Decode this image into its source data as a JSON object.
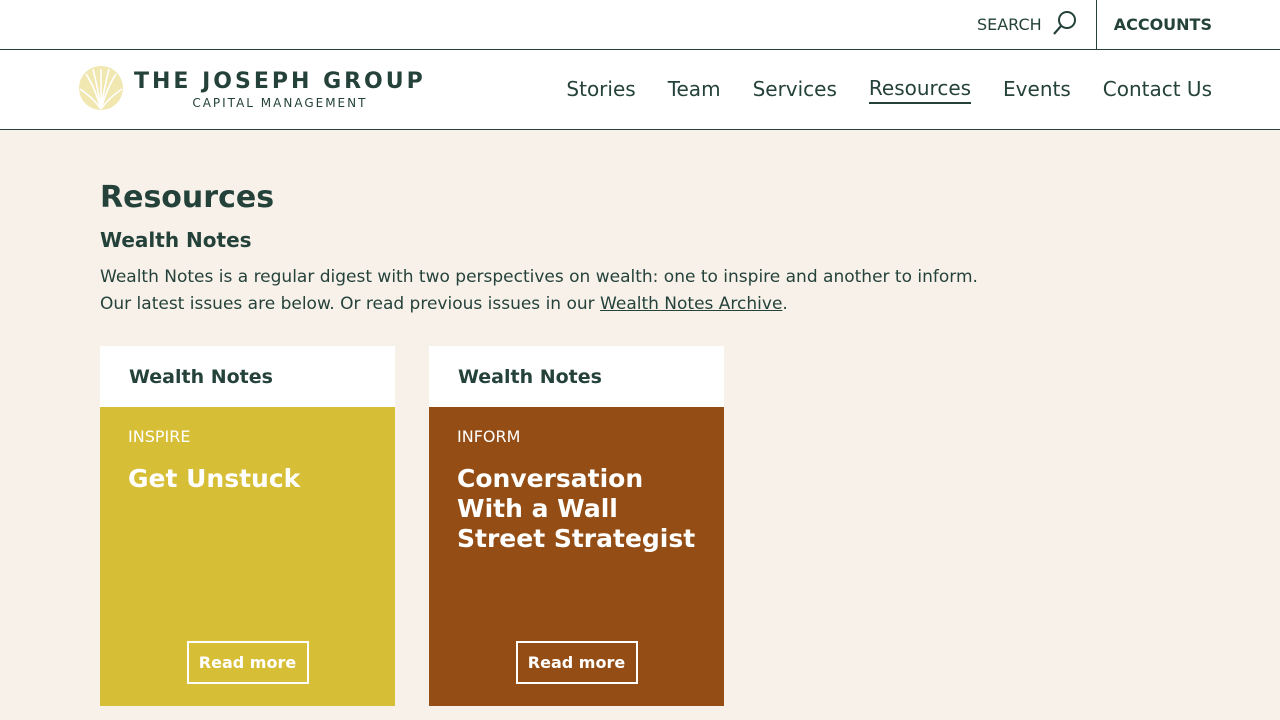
{
  "utility": {
    "search_label": "SEARCH",
    "accounts_label": "ACCOUNTS"
  },
  "brand": {
    "name": "THE JOSEPH GROUP",
    "sub": "CAPITAL MANAGEMENT",
    "logo_icon": "wheat-sun-icon"
  },
  "nav": {
    "items": [
      {
        "label": "Stories"
      },
      {
        "label": "Team"
      },
      {
        "label": "Services"
      },
      {
        "label": "Resources",
        "active": true
      },
      {
        "label": "Events"
      },
      {
        "label": "Contact Us"
      }
    ]
  },
  "page": {
    "title": "Resources",
    "section_title": "Wealth Notes",
    "intro_line1": "Wealth Notes is a regular digest with two perspectives on wealth: one to inspire and another to inform.",
    "intro_line2_prefix": "Our latest issues are below. Or read previous issues in our ",
    "intro_link": "Wealth Notes Archive",
    "intro_line2_suffix": "."
  },
  "cards": [
    {
      "header": "Wealth Notes",
      "kicker": "INSPIRE",
      "title": "Get Unstuck",
      "button": "Read more",
      "color": "#d7be37"
    },
    {
      "header": "Wealth Notes",
      "kicker": "INFORM",
      "title": "Conversation With a Wall Street Strategist",
      "button": "Read more",
      "color": "#944e15"
    }
  ],
  "colors": {
    "primary": "#24423a",
    "background": "#f7f1ea",
    "inspire": "#d7be37",
    "inform": "#944e15"
  }
}
